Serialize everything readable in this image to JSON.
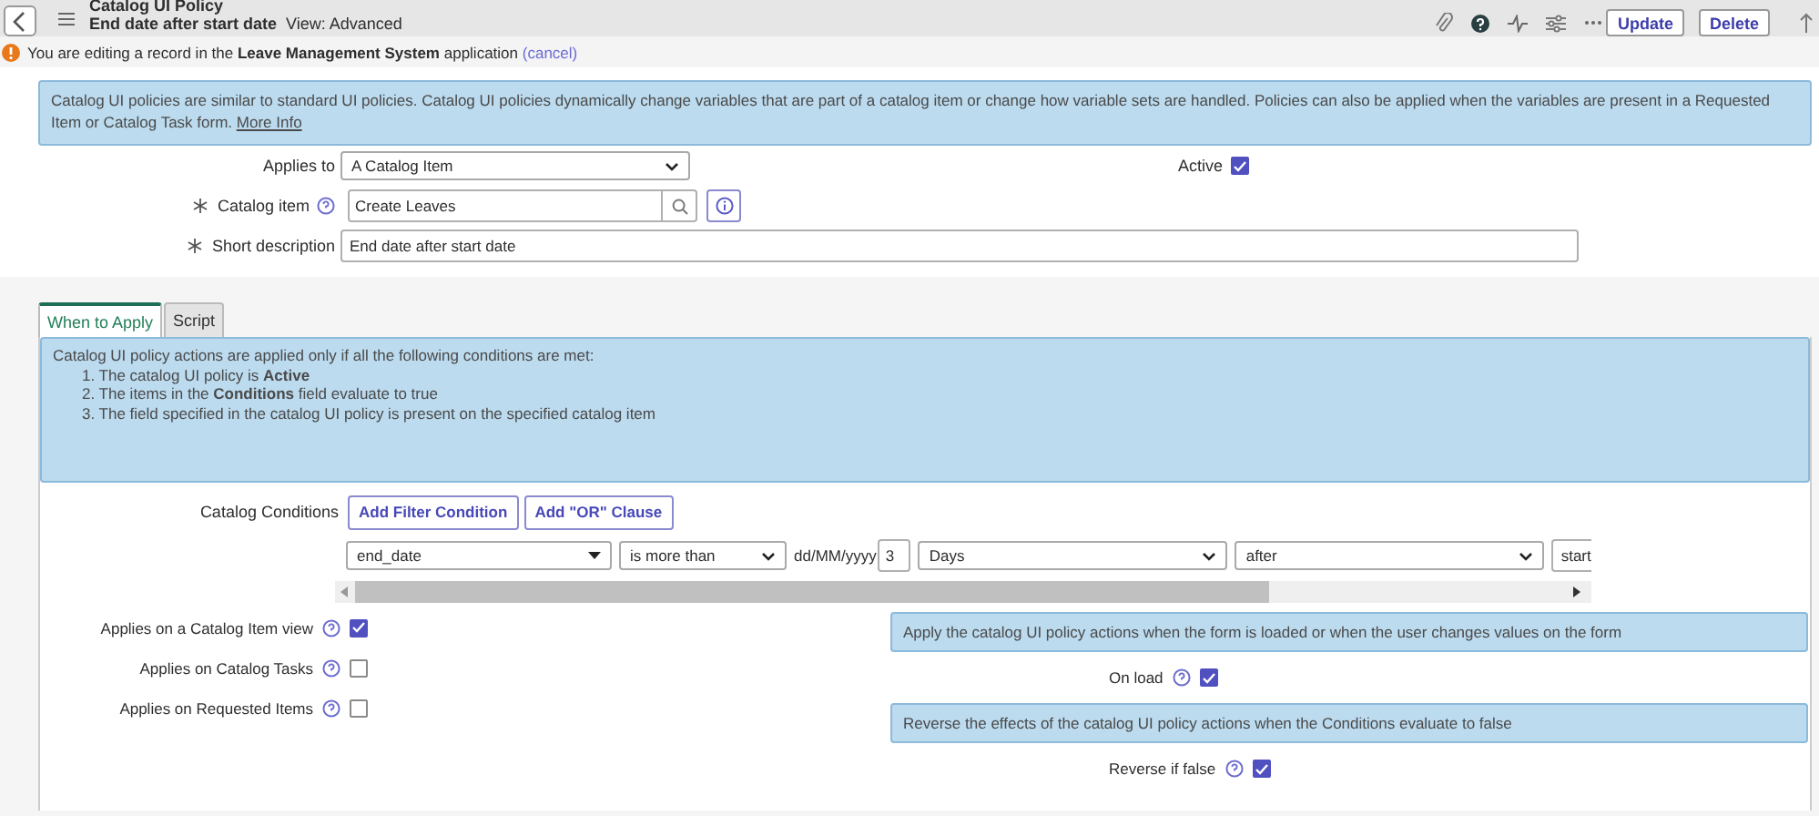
{
  "header": {
    "title": "Catalog UI Policy",
    "record": "End date after start date",
    "view": "View: Advanced",
    "buttons": [
      "Update",
      "Delete"
    ]
  },
  "notice": {
    "text": "You are editing a record in the **Leave Management System** application",
    "link": "(cancel)"
  },
  "info": {
    "text": "Catalog UI policies are similar to standard UI policies. Catalog UI policies dynamically change variables that are part of a catalog item or change how variable sets are handled. Policies can also be applied when the variables are present in a Requested Item or Catalog Task form.",
    "link": "More Info"
  },
  "form": {
    "applies_to": {
      "label": "Applies to",
      "value": "A Catalog Item"
    },
    "active": {
      "label": "Active",
      "checked": true
    },
    "catalog_item": {
      "label": "Catalog item",
      "value": "Create Leaves",
      "required": true
    },
    "short_description": {
      "label": "Short description",
      "value": "End date after start date",
      "required": true
    }
  },
  "tabs": [
    {
      "label": "When to Apply",
      "selected": true
    },
    {
      "label": "Script",
      "selected": false
    }
  ],
  "conditions_info": {
    "intro": "Catalog UI policy actions are applied only if all the following conditions are met:",
    "items": [
      "1. The catalog UI policy is **Active**",
      "2. The items in the **Conditions** field evaluate to true",
      "3. The field specified in the catalog UI policy is present on the specified catalog item"
    ]
  },
  "catalog_conditions": {
    "label": "Catalog Conditions",
    "buttons": [
      "Add Filter Condition",
      "Add \"OR\" Clause"
    ],
    "condition": {
      "field": "end_date",
      "operator": "is more than",
      "format": "dd/MM/yyyy",
      "number": "3",
      "unit": "Days",
      "direction": "after",
      "target": "start"
    }
  },
  "applies_on": [
    {
      "label": "Applies on a Catalog Item view",
      "checked": true
    },
    {
      "label": "Applies on Catalog Tasks",
      "checked": false
    },
    {
      "label": "Applies on Requested Items",
      "checked": false
    }
  ],
  "options": [
    {
      "hint": "Apply the catalog UI policy actions when the form is loaded or when the user changes values on the form",
      "label": "On load",
      "checked": true
    },
    {
      "hint": "Reverse the effects of the catalog UI policy actions when the Conditions evaluate to false",
      "label": "Reverse if false",
      "checked": true
    }
  ]
}
